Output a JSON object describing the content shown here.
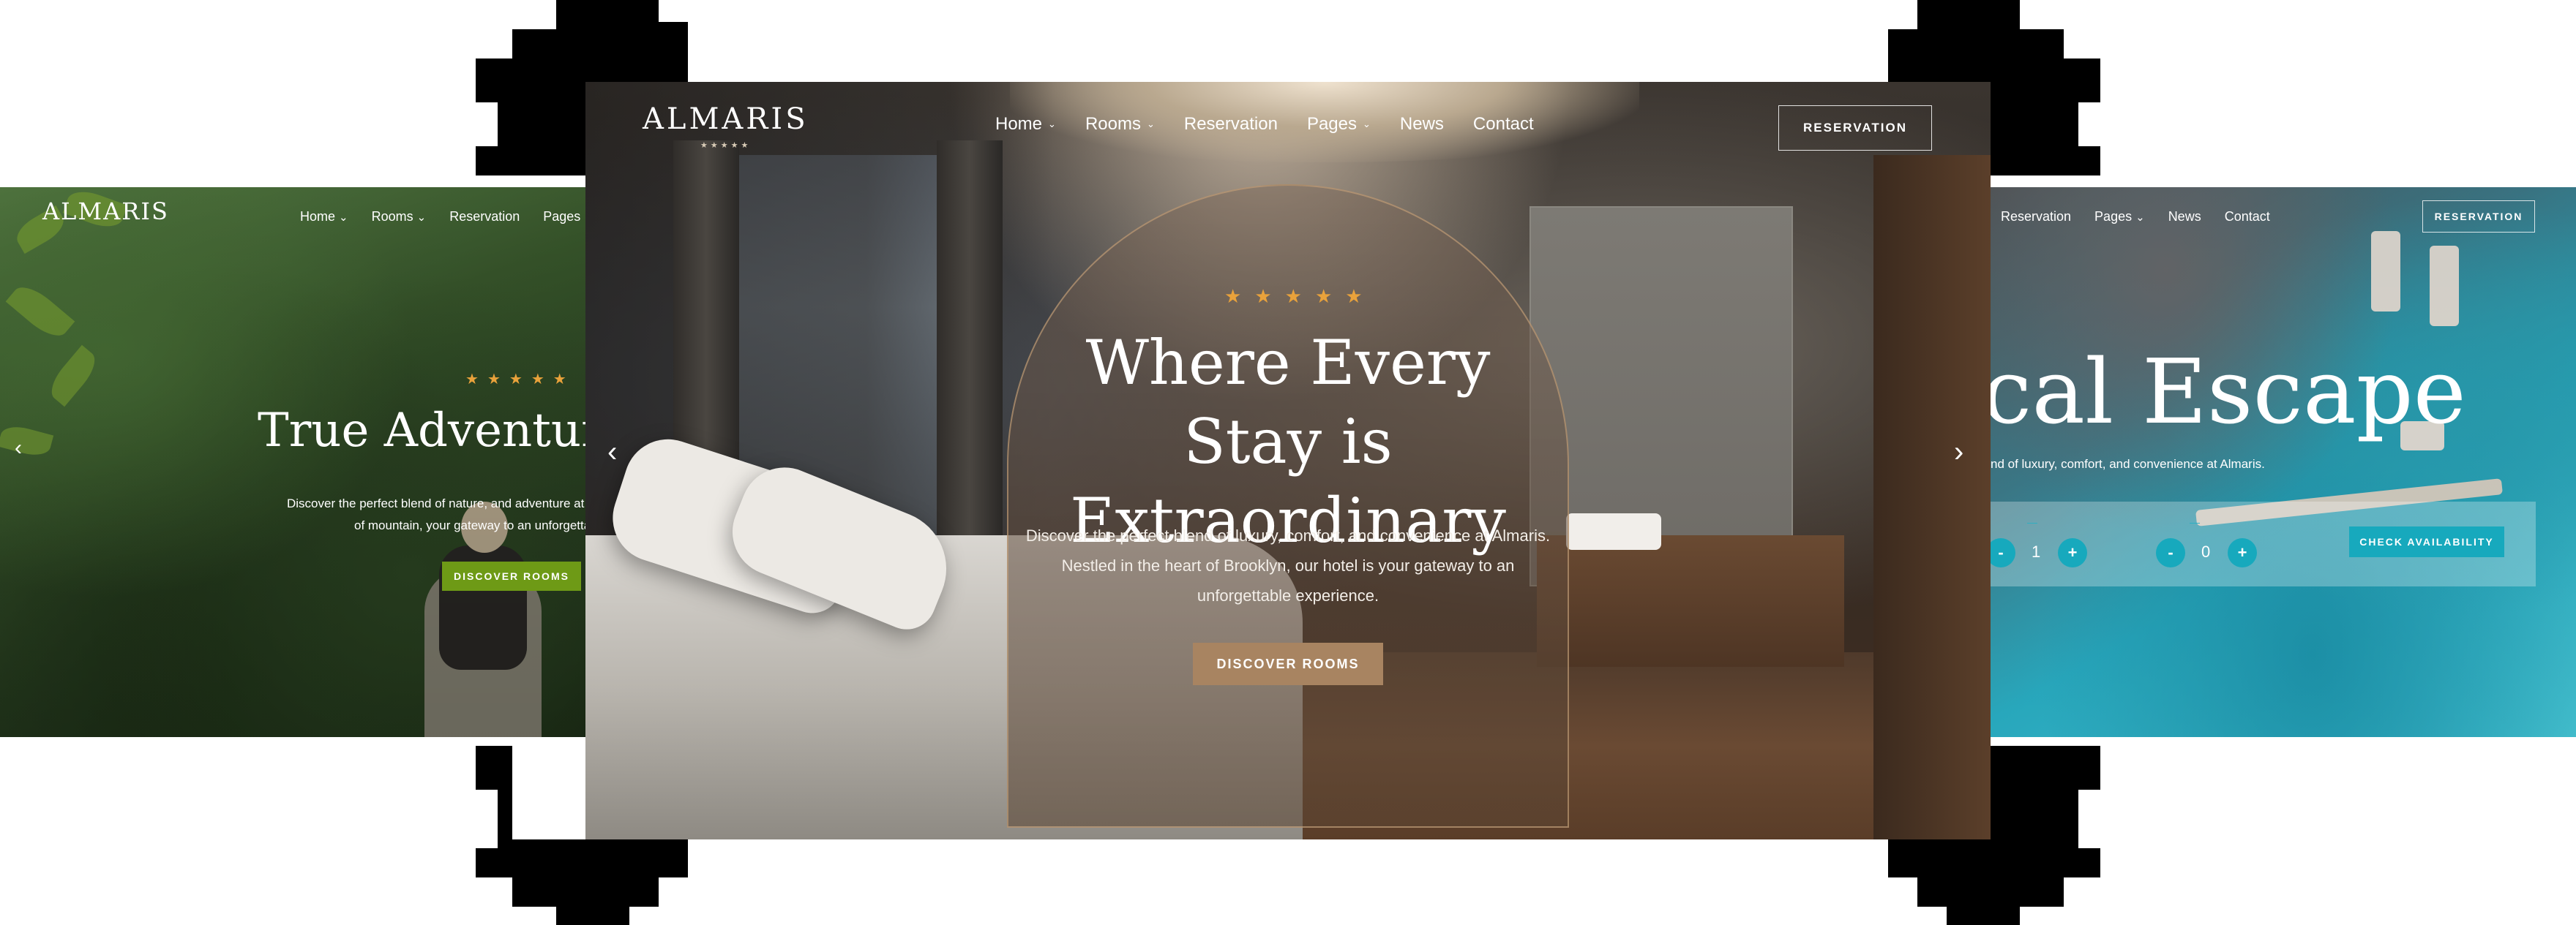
{
  "colors": {
    "accent_gold": "#a88461",
    "star_orange": "#e9a23b",
    "adventure_green": "#6e9a16",
    "teal": "#17a9bd"
  },
  "left_card": {
    "logo": "ALMARIS",
    "nav": [
      "Home",
      "Rooms",
      "Reservation",
      "Pages"
    ],
    "stars": 5,
    "title": "True Adventur",
    "text_line1": "Discover the perfect blend of nature, and adventure at A",
    "text_line2": "of mountain, your gateway to an unforgetta",
    "button": "DISCOVER ROOMS"
  },
  "main": {
    "logo": "ALMARIS",
    "logo_stars": "★★★★★",
    "nav": [
      {
        "label": "Home",
        "dropdown": true
      },
      {
        "label": "Rooms",
        "dropdown": true
      },
      {
        "label": "Reservation",
        "dropdown": false
      },
      {
        "label": "Pages",
        "dropdown": true
      },
      {
        "label": "News",
        "dropdown": false
      },
      {
        "label": "Contact",
        "dropdown": false
      }
    ],
    "reservation_button": "RESERVATION",
    "stars": 5,
    "title_line1": "Where Every Stay is",
    "title_line2": "Extraordinary",
    "description": "Discover the perfect blend of luxury, comfort, and convenience at Almaris. Nestled in the heart of Brooklyn, our hotel is your gateway to an unforgettable experience.",
    "discover_button": "DISCOVER ROOMS",
    "prev_icon": "chevron-left-icon",
    "next_icon": "chevron-right-icon"
  },
  "right_card": {
    "nav": [
      "Reservation",
      "Pages",
      "News",
      "Contact"
    ],
    "reservation_button": "RESERVATION",
    "title": "cal Escape",
    "text": "nd of luxury, comfort, and convenience at Almaris.",
    "booking": {
      "value1": "1",
      "value2": "0",
      "minus": "-",
      "plus": "+",
      "check_button": "CHECK AVAILABILITY"
    }
  }
}
